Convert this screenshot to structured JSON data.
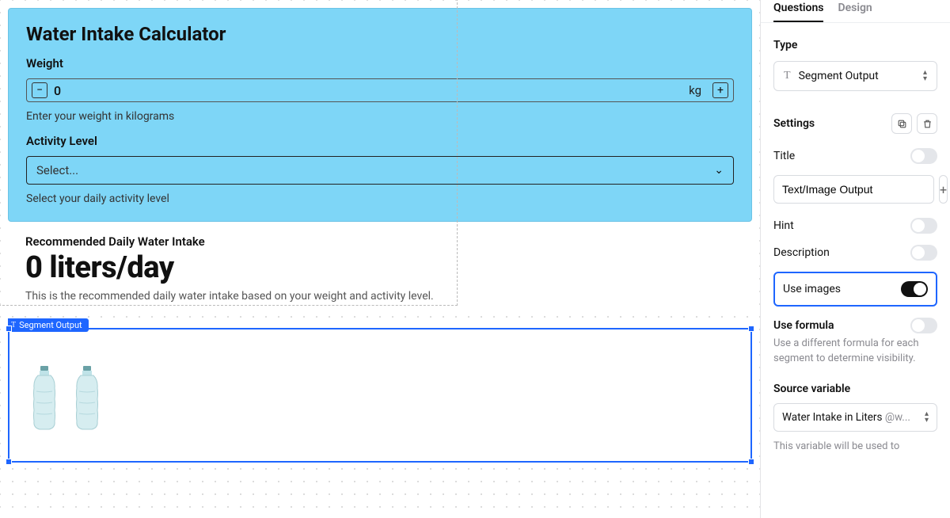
{
  "canvas": {
    "title": "Water Intake Calculator",
    "weight": {
      "label": "Weight",
      "value": "0",
      "unit": "kg",
      "hint": "Enter your weight in kilograms"
    },
    "activity": {
      "label": "Activity Level",
      "placeholder": "Select...",
      "hint": "Select your daily activity level"
    },
    "output": {
      "label": "Recommended Daily Water Intake",
      "value": "0 liters/day",
      "hint": "This is the recommended daily water intake based on your weight and activity level."
    },
    "segment_tag": "Segment Output"
  },
  "sidebar": {
    "tabs": {
      "questions": "Questions",
      "design": "Design"
    },
    "type": {
      "label": "Type",
      "value": "Segment Output"
    },
    "settings_label": "Settings",
    "title_row": {
      "label": "Title",
      "input_value": "Text/Image Output",
      "on": false
    },
    "hint_row": {
      "label": "Hint",
      "on": false
    },
    "description_row": {
      "label": "Description",
      "on": false
    },
    "use_images": {
      "label": "Use images",
      "on": true
    },
    "use_formula": {
      "label": "Use formula",
      "on": false,
      "hint": "Use a different formula for each segment to determine visibility."
    },
    "source": {
      "label": "Source variable",
      "value": "Water Intake in Liters",
      "at": "@w...",
      "hint": "This variable will be used to"
    }
  }
}
